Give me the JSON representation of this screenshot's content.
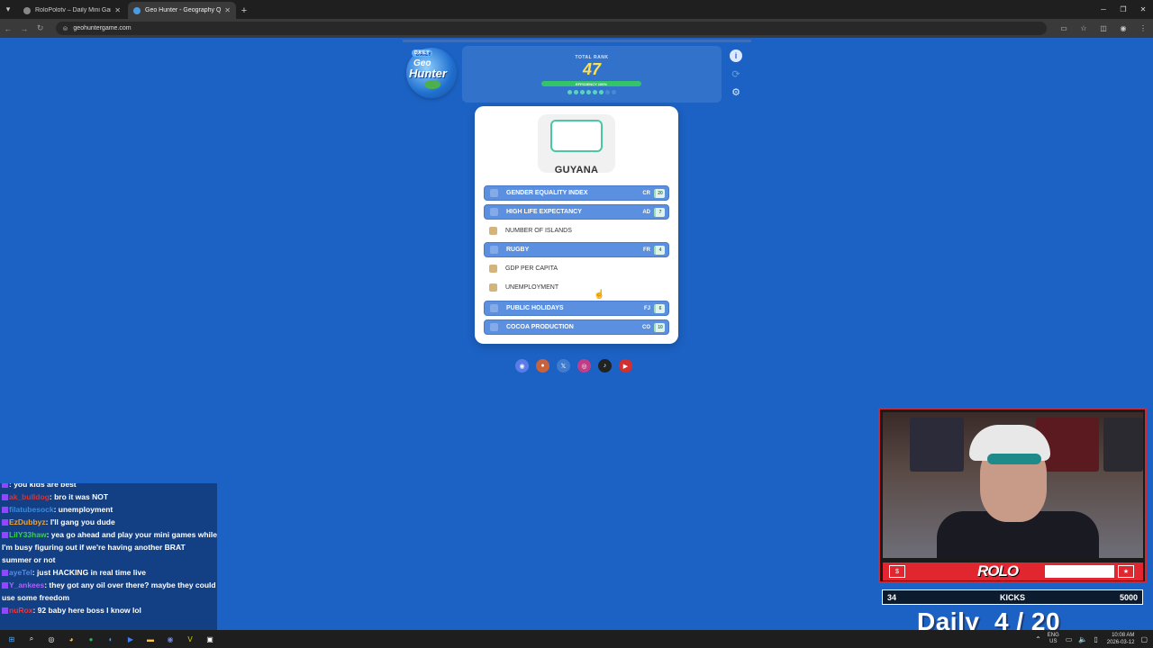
{
  "browser": {
    "tabs": [
      {
        "label": "RoloPolotv – Daily Mini Game H",
        "active": false
      },
      {
        "label": "Geo Hunter - Geography Quiz",
        "active": true
      }
    ],
    "url": "geohuntergame.com"
  },
  "game": {
    "logo": {
      "badge": "DAILY",
      "line1": "Geo",
      "line2": "Hunter"
    },
    "rank_label": "TOTAL RANK",
    "rank_value": "47",
    "efficiency_label": "EFFICIENCY 100%",
    "efficiency_percent": 100,
    "progress_dots": [
      "done",
      "done",
      "done",
      "done",
      "done",
      "done",
      "pending",
      "pending"
    ],
    "side_icons": [
      "info-icon",
      "refresh-icon",
      "gear-icon"
    ],
    "country": "GUYANA",
    "categories": [
      {
        "label": "GENDER EQUALITY INDEX",
        "used": true,
        "code": "CR",
        "rank": "20",
        "icon": "gender-icon"
      },
      {
        "label": "HIGH LIFE EXPECTANCY",
        "used": true,
        "code": "AD",
        "rank": "7",
        "icon": "heart-icon"
      },
      {
        "label": "NUMBER OF ISLANDS",
        "used": false,
        "code": "",
        "rank": "",
        "icon": "palm-tree-icon"
      },
      {
        "label": "RUGBY",
        "used": true,
        "code": "FR",
        "rank": "4",
        "icon": "rugby-ball-icon"
      },
      {
        "label": "GDP PER CAPITA",
        "used": false,
        "code": "",
        "rank": "",
        "icon": "money-icon"
      },
      {
        "label": "UNEMPLOYMENT",
        "used": false,
        "code": "",
        "rank": "",
        "icon": "chart-down-icon"
      },
      {
        "label": "PUBLIC HOLIDAYS",
        "used": true,
        "code": "FJ",
        "rank": "6",
        "icon": "calendar-icon"
      },
      {
        "label": "COCOA PRODUCTION",
        "used": true,
        "code": "CO",
        "rank": "10",
        "icon": "cocoa-icon"
      }
    ],
    "social": [
      "discord-icon",
      "reddit-icon",
      "x-icon",
      "instagram-icon",
      "tiktok-icon",
      "youtube-icon"
    ]
  },
  "chat": [
    {
      "user": "",
      "text": ": you kids are best",
      "color": "#ff4040"
    },
    {
      "user": "ak_bulldog",
      "text": ": bro it was NOT",
      "color": "#e03030"
    },
    {
      "user": "filatubesock",
      "text": ": unemployment",
      "color": "#3a8ae0"
    },
    {
      "user": "EzDubbyz",
      "text": ": I'll gang you dude",
      "color": "#f0a030"
    },
    {
      "user": "LilY33haw",
      "text": ": yea go ahead and play your mini games while I'm busy figuring out if we're having another BRAT summer or not",
      "color": "#3ad04a"
    },
    {
      "user": "ayeTel",
      "text": ": just HACKING in real time live",
      "color": "#5a8ae0"
    },
    {
      "user": "Y_ankees",
      "text": ": they got any oil over there? maybe they could use some freedom",
      "color": "#b060ff"
    },
    {
      "user": "nuRox",
      "text": ": 92 baby here boss I know lol",
      "color": "#ff3030"
    }
  ],
  "stream": {
    "brand": "ROLO",
    "left_badge": "$",
    "right_badge": "★",
    "kicks_left": "34",
    "kicks_label": "KICKS",
    "kicks_right": "5000",
    "daily_text": "Daily  4 / 20"
  },
  "taskbar": {
    "lang": "ENG",
    "region": "US",
    "time": "10:08 AM",
    "date": "2026-03-12"
  }
}
